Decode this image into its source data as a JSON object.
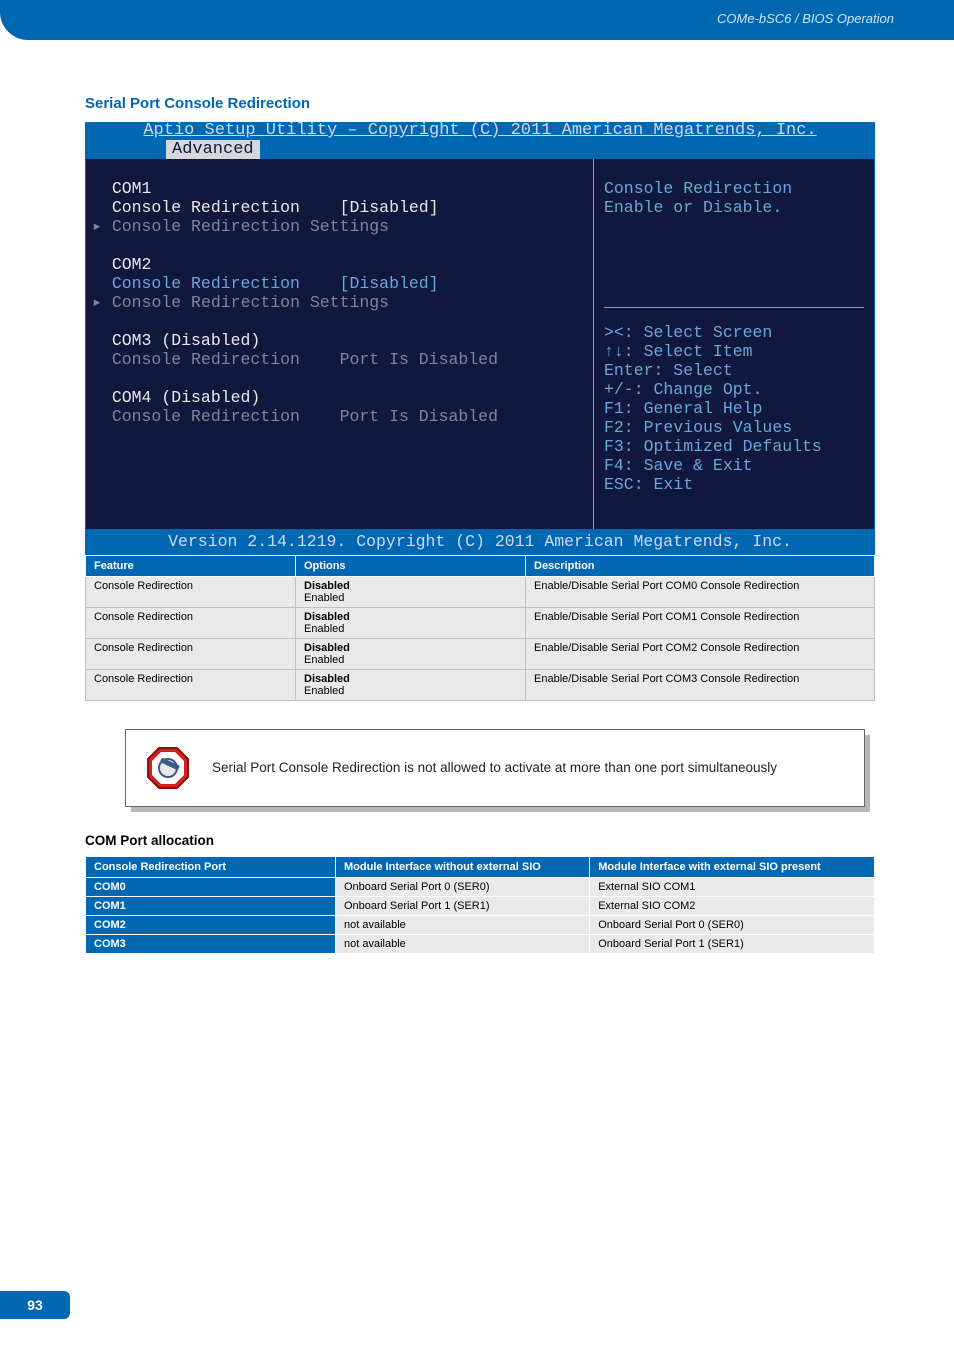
{
  "breadcrumb": "COMe-bSC6 / BIOS Operation",
  "section_title": "Serial Port Console Redirection",
  "bios": {
    "title": "Aptio Setup Utility – Copyright (C) 2011 American Megatrends, Inc.",
    "tab": "Advanced",
    "com1": {
      "label": "COM1",
      "cr_label": "Console Redirection",
      "cr_value": "[Disabled]",
      "settings": "Console Redirection Settings"
    },
    "com2": {
      "label": "COM2",
      "cr_label": "Console Redirection",
      "cr_value": "[Disabled]",
      "settings": "Console Redirection Settings"
    },
    "com3": {
      "label": "COM3 (Disabled)",
      "cr_label": "Console Redirection",
      "cr_value": "Port Is Disabled"
    },
    "com4": {
      "label": "COM4 (Disabled)",
      "cr_label": "Console Redirection",
      "cr_value": "Port Is Disabled"
    },
    "help_top": "Console Redirection\nEnable or Disable.",
    "keys": {
      "k1": "><: Select Screen",
      "k2": "↑↓: Select Item",
      "k3": "Enter: Select",
      "k4": "+/-: Change Opt.",
      "k5": "F1: General Help",
      "k6": "F2: Previous Values",
      "k7": "F3: Optimized Defaults",
      "k8": "F4: Save & Exit",
      "k9": "ESC: Exit"
    },
    "footer": "Version 2.14.1219. Copyright (C) 2011 American Megatrends, Inc."
  },
  "options_table": {
    "headers": {
      "feature": "Feature",
      "options": "Options",
      "description": "Description"
    },
    "rows": [
      {
        "feature": "Console Redirection",
        "opt_bold": "Disabled",
        "opt2": "Enabled",
        "desc": "Enable/Disable Serial Port COM0 Console Redirection"
      },
      {
        "feature": "Console Redirection",
        "opt_bold": "Disabled",
        "opt2": "Enabled",
        "desc": "Enable/Disable Serial Port COM1 Console Redirection"
      },
      {
        "feature": "Console Redirection",
        "opt_bold": "Disabled",
        "opt2": "Enabled",
        "desc": "Enable/Disable Serial Port COM2 Console Redirection"
      },
      {
        "feature": "Console Redirection",
        "opt_bold": "Disabled",
        "opt2": "Enabled",
        "desc": "Enable/Disable Serial Port COM3 Console Redirection"
      }
    ]
  },
  "note": "Serial Port Console Redirection is not allowed to activate at more than one port simultaneously",
  "alloc_title": "COM Port allocation",
  "alloc_table": {
    "headers": {
      "port": "Console Redirection Port",
      "noext": "Module Interface without external SIO",
      "ext": "Module Interface with external SIO present"
    },
    "rows": [
      {
        "port": "COM0",
        "noext": "Onboard Serial Port 0 (SER0)",
        "ext": "External SIO COM1"
      },
      {
        "port": "COM1",
        "noext": "Onboard Serial Port 1 (SER1)",
        "ext": "External SIO COM2"
      },
      {
        "port": "COM2",
        "noext": "not available",
        "ext": "Onboard Serial Port 0 (SER0)"
      },
      {
        "port": "COM3",
        "noext": "not available",
        "ext": "Onboard Serial Port 1 (SER1)"
      }
    ]
  },
  "page_number": "93"
}
